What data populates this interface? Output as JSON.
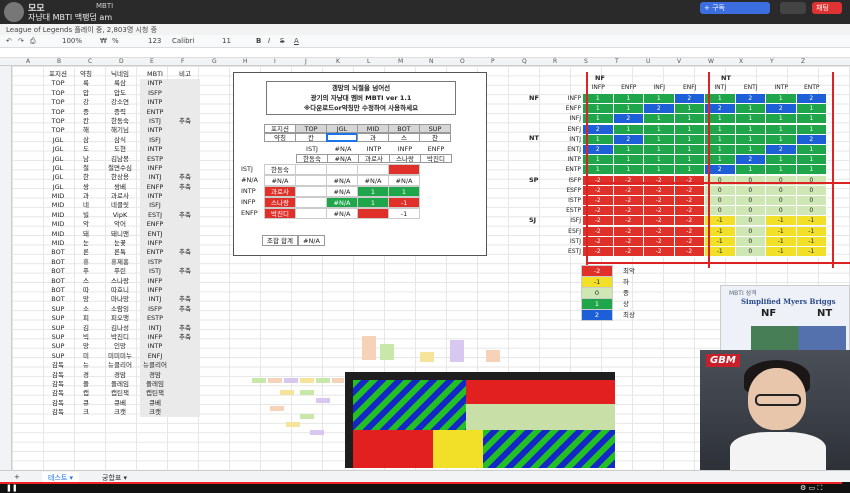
{
  "stream": {
    "channel": "모모",
    "title": "자냥대 MBTI 맥팽덤 am",
    "subtitle": "League of Legends 플레이 중, 2,803명 시청 중",
    "mid_text": "MBTI",
    "follow_label": "+ 구독",
    "chat_label": "채팅"
  },
  "toolbar": {
    "zoom": "100%",
    "font": "Calibri",
    "size": "11",
    "currency": "₩",
    "pct": "%",
    "fmt": "123"
  },
  "columns": [
    "A",
    "B",
    "C",
    "D",
    "E",
    "F",
    "G",
    "H",
    "I",
    "J",
    "K",
    "L",
    "M",
    "N",
    "O",
    "P",
    "Q",
    "R",
    "S",
    "T",
    "U",
    "V",
    "W",
    "X",
    "Y",
    "Z"
  ],
  "roster": {
    "headers": [
      "포지션",
      "약칭",
      "닉네임",
      "MBTI",
      "비고"
    ],
    "rows": [
      [
        "TOP",
        "룩",
        "룩삼",
        "INTP",
        ""
      ],
      [
        "TOP",
        "압",
        "압도",
        "ISFP",
        ""
      ],
      [
        "TOP",
        "강",
        "강소연",
        "INTP",
        ""
      ],
      [
        "TOP",
        "증",
        "증력",
        "ENTP",
        ""
      ],
      [
        "TOP",
        "칸",
        "한동숙",
        "ISTJ",
        "추축"
      ],
      [
        "TOP",
        "해",
        "해기님",
        "INTP",
        ""
      ],
      [
        "JGL",
        "삼",
        "삼식",
        "ISFJ",
        ""
      ],
      [
        "JGL",
        "도",
        "도현",
        "INTP",
        ""
      ],
      [
        "JGL",
        "남",
        "김남봉",
        "ESTP",
        ""
      ],
      [
        "JGL",
        "철",
        "철면수심",
        "INFP",
        ""
      ],
      [
        "JGL",
        "한",
        "한상용",
        "INTJ",
        "추축"
      ],
      [
        "JGL",
        "쌍",
        "쌍베",
        "ENFP",
        "추축"
      ],
      [
        "MID",
        "과",
        "과로사",
        "INTP",
        ""
      ],
      [
        "MID",
        "네",
        "네클릿",
        "ISFJ",
        ""
      ],
      [
        "MID",
        "빌",
        "VipK",
        "ESTJ",
        "추축"
      ],
      [
        "MID",
        "악",
        "악어",
        "ENFP",
        ""
      ],
      [
        "MID",
        "돼",
        "돼니맨",
        "ENTJ",
        ""
      ],
      [
        "MID",
        "눈",
        "눈꽃",
        "INFP",
        ""
      ],
      [
        "BOT",
        "론",
        "론툭",
        "ENTP",
        "추축"
      ],
      [
        "BOT",
        "휴",
        "휴제홍",
        "ISTP",
        ""
      ],
      [
        "BOT",
        "푸",
        "푸린",
        "ISTJ",
        "추축"
      ],
      [
        "BOT",
        "스",
        "스나랑",
        "INFP",
        ""
      ],
      [
        "BOT",
        "따",
        "따효니",
        "INFP",
        ""
      ],
      [
        "BOT",
        "망",
        "마나망",
        "INTJ",
        "추축"
      ],
      [
        "SUP",
        "소",
        "소람잉",
        "ISFP",
        "추축"
      ],
      [
        "SUP",
        "피",
        "피오맹",
        "ESTP",
        ""
      ],
      [
        "SUP",
        "김",
        "김나성",
        "INTJ",
        "추축"
      ],
      [
        "SUP",
        "빅",
        "박진디",
        "INFP",
        "추축"
      ],
      [
        "SUP",
        "망",
        "인망",
        "INTP",
        ""
      ],
      [
        "SUP",
        "미",
        "미미미누",
        "ENFJ",
        ""
      ],
      [
        "감독",
        "뉴",
        "뉴클리어",
        "뉴클리어",
        ""
      ],
      [
        "감독",
        "경",
        "경맘",
        "경맘",
        ""
      ],
      [
        "감독",
        "플",
        "플레임",
        "플레임",
        ""
      ],
      [
        "감독",
        "캡",
        "캡틴잭",
        "캡틴잭",
        ""
      ],
      [
        "감독",
        "큐",
        "큐베",
        "큐베",
        ""
      ],
      [
        "감독",
        "크",
        "크캣",
        "크캣",
        ""
      ]
    ]
  },
  "calc": {
    "title_lines": [
      "갱망의 뇌절을 넘어선",
      "광기의 자냥대 멤버 MBTI ver 1.1",
      "※다운로드or약칭만 수정하여 사용하세요"
    ],
    "pos_label": "포지션",
    "abbr_label": "약칭",
    "positions": [
      "TOP",
      "JGL",
      "MID",
      "BOT",
      "SUP"
    ],
    "picks": [
      "칸",
      "",
      "과",
      "스",
      "찬"
    ],
    "mbti_row": [
      "ISTJ",
      "#N/A",
      "INTP",
      "INFP",
      "ENFP"
    ],
    "names_row": [
      "한동숙",
      "#N/A",
      "과로사",
      "스나랑",
      "박진디"
    ],
    "matrix": [
      {
        "lab": "ISTJ",
        "cells": [
          "한동숙",
          "",
          "",
          "",
          ""
        ],
        "cls": [
          "",
          "",
          "",
          "",
          "red"
        ]
      },
      {
        "lab": "#N/A",
        "cells": [
          "#N/A",
          "",
          "#N/A",
          "#N/A",
          "#N/A"
        ],
        "cls": [
          "",
          "",
          "",
          "",
          ""
        ]
      },
      {
        "lab": "INTP",
        "cells": [
          "과로사",
          "",
          "#N/A",
          "1",
          "1"
        ],
        "cls": [
          "red",
          "",
          "",
          "grn",
          "grn"
        ]
      },
      {
        "lab": "INFP",
        "cells": [
          "스나랑",
          "",
          "#N/A",
          "1",
          "-1"
        ],
        "cls": [
          "red",
          "",
          "grn",
          "grn",
          "red"
        ]
      },
      {
        "lab": "ENFP",
        "cells": [
          "박진디",
          "",
          "#N/A",
          "",
          "-1"
        ],
        "cls": [
          "red",
          "",
          "",
          "red",
          ""
        ]
      }
    ],
    "sum_label": "조합 합계",
    "sum_value": "#N/A"
  },
  "mbti_grid": {
    "group_nf": "NF",
    "group_nt": "NT",
    "group_sp": "SP",
    "group_sj": "SJ",
    "col_heads": [
      "INFP",
      "ENFP",
      "INFJ",
      "ENFJ",
      "INTJ",
      "ENTJ",
      "INTP",
      "ENTP"
    ],
    "rows": [
      {
        "lab": "INFP",
        "vals": [
          "1",
          "1",
          "1",
          "2",
          "1",
          "2",
          "1",
          "2"
        ],
        "cls": [
          "grn",
          "grn",
          "grn",
          "blu",
          "grn",
          "blu",
          "grn",
          "blu"
        ]
      },
      {
        "lab": "ENFP",
        "vals": [
          "1",
          "1",
          "2",
          "1",
          "2",
          "1",
          "2",
          "1"
        ],
        "cls": [
          "grn",
          "grn",
          "blu",
          "grn",
          "blu",
          "grn",
          "blu",
          "grn"
        ]
      },
      {
        "lab": "INFJ",
        "vals": [
          "1",
          "2",
          "1",
          "1",
          "1",
          "1",
          "1",
          "1"
        ],
        "cls": [
          "grn",
          "blu",
          "grn",
          "grn",
          "grn",
          "grn",
          "grn",
          "grn"
        ]
      },
      {
        "lab": "ENFJ",
        "vals": [
          "2",
          "1",
          "1",
          "1",
          "1",
          "1",
          "1",
          "1"
        ],
        "cls": [
          "blu",
          "grn",
          "grn",
          "grn",
          "grn",
          "grn",
          "grn",
          "grn"
        ]
      },
      {
        "lab": "INTJ",
        "vals": [
          "1",
          "2",
          "1",
          "1",
          "1",
          "1",
          "1",
          "2"
        ],
        "cls": [
          "grn",
          "blu",
          "grn",
          "grn",
          "grn",
          "grn",
          "grn",
          "blu"
        ]
      },
      {
        "lab": "ENTJ",
        "vals": [
          "2",
          "1",
          "1",
          "1",
          "1",
          "1",
          "2",
          "1"
        ],
        "cls": [
          "blu",
          "grn",
          "grn",
          "grn",
          "grn",
          "grn",
          "blu",
          "grn"
        ]
      },
      {
        "lab": "INTP",
        "vals": [
          "1",
          "1",
          "1",
          "1",
          "1",
          "2",
          "1",
          "1"
        ],
        "cls": [
          "grn",
          "grn",
          "grn",
          "grn",
          "grn",
          "blu",
          "grn",
          "grn"
        ]
      },
      {
        "lab": "ENTP",
        "vals": [
          "1",
          "1",
          "1",
          "1",
          "2",
          "1",
          "1",
          "1"
        ],
        "cls": [
          "grn",
          "grn",
          "grn",
          "grn",
          "blu",
          "grn",
          "grn",
          "grn"
        ]
      },
      {
        "lab": "ISFP",
        "vals": [
          "-2",
          "-2",
          "-2",
          "-2",
          "0",
          "0",
          "0",
          "0"
        ],
        "cls": [
          "red",
          "red",
          "red",
          "red",
          "lgy",
          "lgy",
          "lgy",
          "lgy"
        ]
      },
      {
        "lab": "ESFP",
        "vals": [
          "-2",
          "-2",
          "-2",
          "-2",
          "0",
          "0",
          "0",
          "0"
        ],
        "cls": [
          "red",
          "red",
          "red",
          "red",
          "lgy",
          "lgy",
          "lgy",
          "lgy"
        ]
      },
      {
        "lab": "ISTP",
        "vals": [
          "-2",
          "-2",
          "-2",
          "-2",
          "0",
          "0",
          "0",
          "0"
        ],
        "cls": [
          "red",
          "red",
          "red",
          "red",
          "lgy",
          "lgy",
          "lgy",
          "lgy"
        ]
      },
      {
        "lab": "ESTP",
        "vals": [
          "-2",
          "-2",
          "-2",
          "-2",
          "0",
          "0",
          "0",
          "0"
        ],
        "cls": [
          "red",
          "red",
          "red",
          "red",
          "lgy",
          "lgy",
          "lgy",
          "lgy"
        ]
      },
      {
        "lab": "ISFJ",
        "vals": [
          "-2",
          "-2",
          "-2",
          "-2",
          "-1",
          "0",
          "-1",
          "-1"
        ],
        "cls": [
          "red",
          "red",
          "red",
          "red",
          "yel",
          "lgy",
          "yel",
          "yel"
        ]
      },
      {
        "lab": "ESFJ",
        "vals": [
          "-2",
          "-2",
          "-2",
          "-2",
          "-1",
          "0",
          "-1",
          "-1"
        ],
        "cls": [
          "red",
          "red",
          "red",
          "red",
          "yel",
          "lgy",
          "yel",
          "yel"
        ]
      },
      {
        "lab": "ISTJ",
        "vals": [
          "-2",
          "-2",
          "-2",
          "-2",
          "-1",
          "0",
          "-1",
          "-1"
        ],
        "cls": [
          "red",
          "red",
          "red",
          "red",
          "yel",
          "lgy",
          "yel",
          "yel"
        ]
      },
      {
        "lab": "ESTJ",
        "vals": [
          "-2",
          "-2",
          "-2",
          "-2",
          "-1",
          "0",
          "-1",
          "-1"
        ],
        "cls": [
          "red",
          "red",
          "red",
          "red",
          "yel",
          "lgy",
          "yel",
          "yel"
        ]
      }
    ]
  },
  "legend": [
    {
      "v": "-2",
      "t": "최악",
      "cls": "red"
    },
    {
      "v": "-1",
      "t": "하",
      "cls": "yel"
    },
    {
      "v": "0",
      "t": "중",
      "cls": "lgy"
    },
    {
      "v": "1",
      "t": "상",
      "cls": "grn"
    },
    {
      "v": "2",
      "t": "최상",
      "cls": "blu"
    }
  ],
  "ref_chart": {
    "tab": "MBTI 성격",
    "title": "Simplified Myers Briggs",
    "nf": "NF",
    "nt": "NT"
  },
  "webcam": {
    "badge": "GBM"
  },
  "sheet_tabs": [
    "테스트 ▾",
    "궁합표 ▾"
  ],
  "player": {
    "left": "❚❚",
    "right": "⚙  ▭  ⛶"
  }
}
